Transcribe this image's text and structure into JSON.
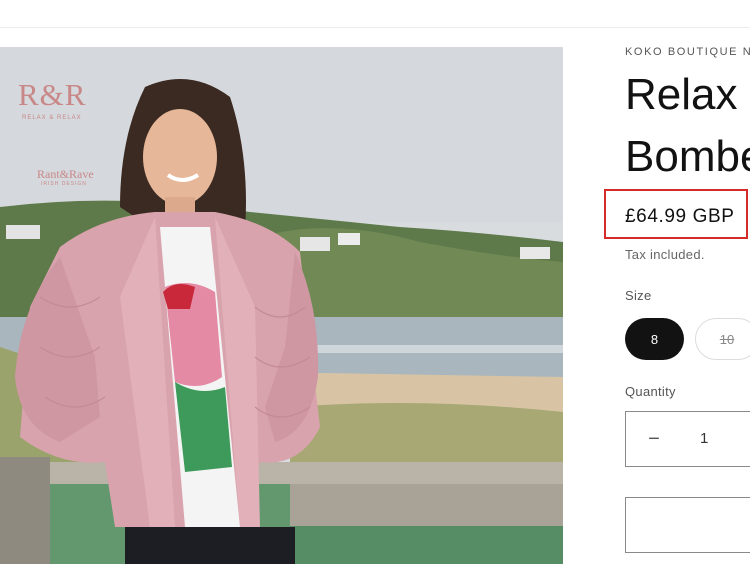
{
  "product": {
    "vendor": "KOKO BOUTIQUE NI",
    "title_line1": "Relax &",
    "title_line2": "Bombe",
    "price": "£64.99 GBP",
    "tax_note": "Tax included.",
    "size_label": "Size",
    "sizes": [
      {
        "label": "8",
        "state": "selected"
      },
      {
        "label": "10",
        "state": "sold-out"
      }
    ],
    "quantity_label": "Quantity",
    "quantity_value": "1",
    "quantity_minus": "−"
  },
  "image": {
    "logo_text": "R&R",
    "logo_subtext": "RELAX & RELAX",
    "brand_text": "Rant&Rave",
    "brand_subtext": "IRISH DESIGN",
    "subject": "woman in pink quilted bomber jacket by the sea"
  },
  "colors": {
    "highlight": "#d62b2b",
    "selected_size_bg": "#121212",
    "jacket": "#d9a3ad"
  }
}
